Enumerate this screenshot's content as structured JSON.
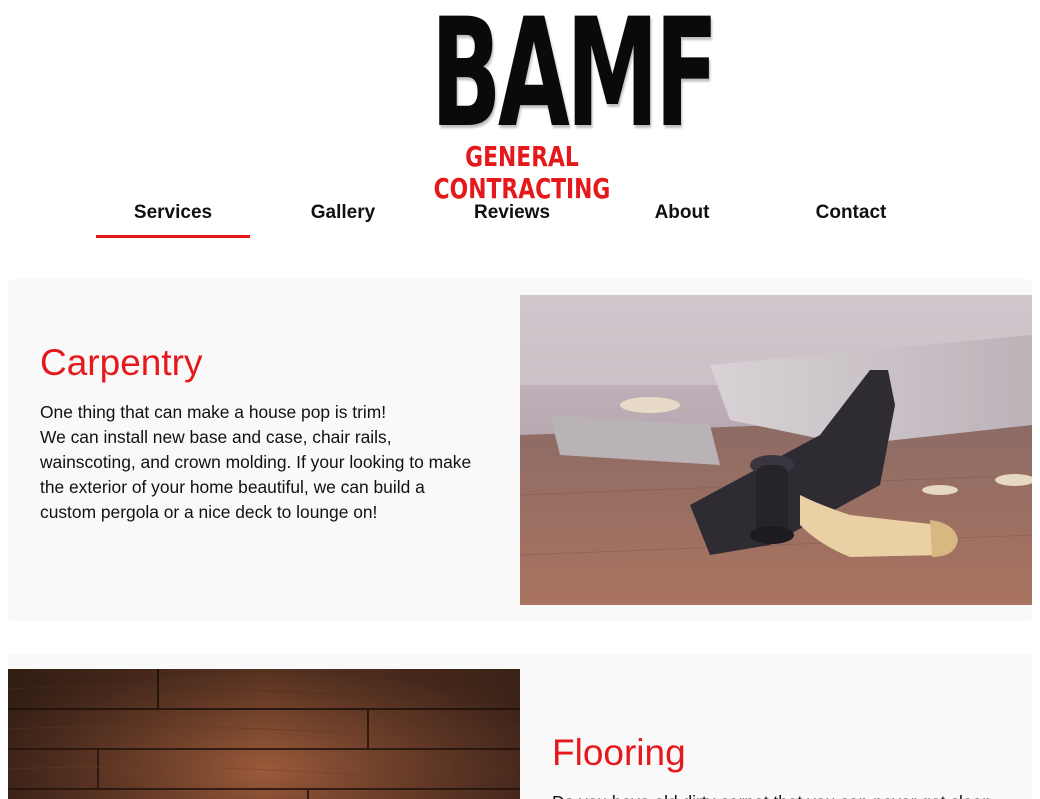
{
  "logo": {
    "main": "BAMF",
    "sub": "GENERAL CONTRACTING"
  },
  "nav": {
    "items": [
      {
        "label": "Services",
        "active": true
      },
      {
        "label": "Gallery",
        "active": false
      },
      {
        "label": "Reviews",
        "active": false
      },
      {
        "label": "About",
        "active": false
      },
      {
        "label": "Contact",
        "active": false
      }
    ]
  },
  "services": [
    {
      "title": "Carpentry",
      "lines": [
        "One thing that can make a house pop is trim!",
        "We can install new base and case, chair rails,",
        "wainscoting, and crown molding. If your looking to make",
        "the exterior of your home beautiful, we can build a",
        "custom pergola or a nice deck to lounge on!"
      ]
    },
    {
      "title": "Flooring",
      "lines": [
        "Do you have old dirty carpet that you can never get clean"
      ]
    }
  ],
  "colors": {
    "accent": "#e5191b",
    "card_bg": "#f9f9f9",
    "text": "#111111"
  }
}
